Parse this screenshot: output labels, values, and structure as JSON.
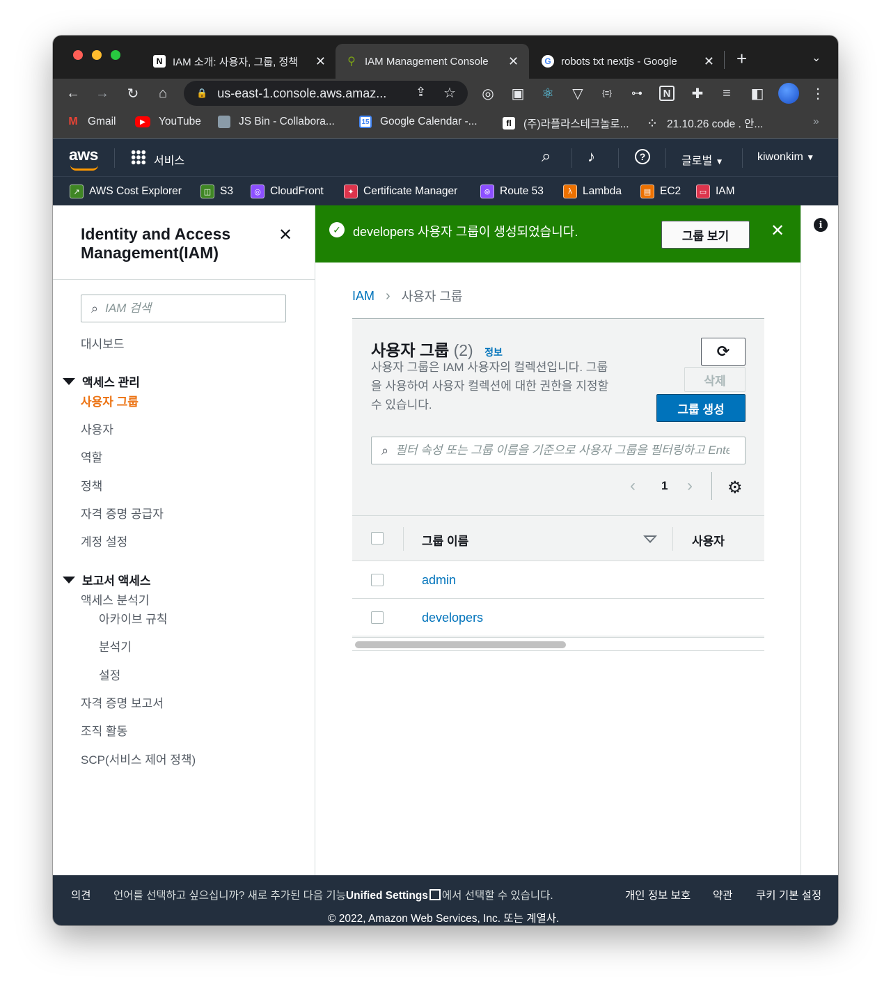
{
  "browser": {
    "traffic_colors": [
      "#ff5f57",
      "#febc2e",
      "#28c840"
    ],
    "tabs": [
      {
        "title": "IAM 소개: 사용자, 그룹, 정책",
        "icon": "notion-icon"
      },
      {
        "title": "IAM Management Console",
        "icon": "aws-key-icon"
      },
      {
        "title": "robots txt nextjs - Google",
        "icon": "google-icon"
      }
    ],
    "url": "us-east-1.console.aws.amaz...",
    "bookmarks": [
      {
        "label": "Gmail",
        "color": "#ea4335"
      },
      {
        "label": "YouTube",
        "color": "#ff0000"
      },
      {
        "label": "JS Bin - Collabora...",
        "color": "#8a9ba8"
      },
      {
        "label": "Google Calendar -...",
        "color": "#4285f4"
      },
      {
        "label": "(주)라플라스테크놀로...",
        "color": "#ffffff"
      },
      {
        "label": "21.10.26 code . 안...",
        "color": "#5f6368"
      }
    ],
    "more": "»"
  },
  "aws": {
    "logo": "aws",
    "services": "서비스",
    "region": "글로벌",
    "user": "kiwonkim",
    "favorites": [
      {
        "label": "AWS Cost Explorer",
        "color": "#3f8624"
      },
      {
        "label": "S3",
        "color": "#3f8624"
      },
      {
        "label": "CloudFront",
        "color": "#8c4fff"
      },
      {
        "label": "Certificate Manager",
        "color": "#dd344c"
      },
      {
        "label": "Route 53",
        "color": "#8c4fff"
      },
      {
        "label": "Lambda",
        "color": "#ed7100"
      },
      {
        "label": "EC2",
        "color": "#ed7100"
      },
      {
        "label": "IAM",
        "color": "#dd344c"
      }
    ]
  },
  "sidebar": {
    "title": "Identity and Access Management(IAM)",
    "search_placeholder": "IAM 검색",
    "dashboard": "대시보드",
    "access_mgmt": "액세스 관리",
    "access_items": [
      "사용자 그룹",
      "사용자",
      "역할",
      "정책",
      "자격 증명 공급자",
      "계정 설정"
    ],
    "report_access": "보고서 액세스",
    "analyzer": "액세스 분석기",
    "analyzer_items": [
      "아카이브 규칙",
      "분석기",
      "설정"
    ],
    "report_items": [
      "자격 증명 보고서",
      "조직 활동",
      "SCP(서비스 제어 정책)"
    ]
  },
  "flash": {
    "message": "developers 사용자 그룹이 생성되었습니다.",
    "button": "그룹 보기"
  },
  "breadcrumb": {
    "root": "IAM",
    "current": "사용자 그룹"
  },
  "groups": {
    "title": "사용자 그룹",
    "count": "(2)",
    "info": "정보",
    "description": "사용자 그룹은 IAM 사용자의 컬렉션입니다. 그룹을 사용하여 사용자 컬렉션에 대한 권한을 지정할 수 있습니다.",
    "delete": "삭제",
    "create": "그룹 생성",
    "filter_placeholder": "필터 속성 또는 그룹 이름을 기준으로 사용자 그룹을 필터링하고 Enter",
    "page": "1",
    "columns": [
      "그룹 이름",
      "사용자"
    ],
    "rows": [
      {
        "name": "admin"
      },
      {
        "name": "developers"
      }
    ]
  },
  "footer": {
    "feedback": "의견",
    "lang_pre": "언어를 선택하고 싶으십니까? 새로 추가된 다음 기능",
    "lang_link": "Unified Settings",
    "lang_post": "에서 선택할 수 있습니다.",
    "privacy": "개인 정보 보호",
    "terms": "약관",
    "cookies": "쿠키 기본 설정",
    "copyright": "© 2022, Amazon Web Services, Inc. 또는 계열사."
  }
}
